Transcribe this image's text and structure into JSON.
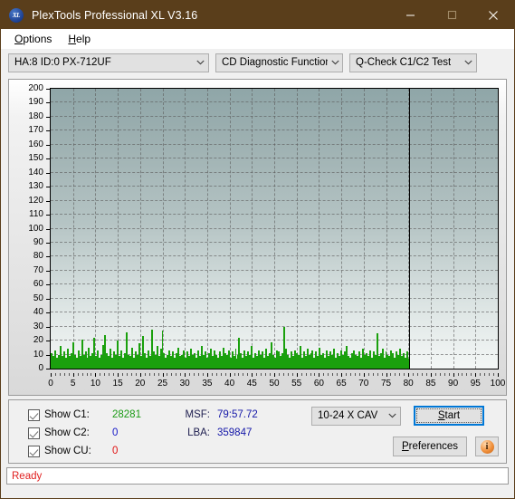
{
  "window": {
    "title": "PlexTools Professional XL V3.16",
    "icon": "xl-app-icon",
    "icon_text": "XL",
    "minimize_label": "minimize-icon",
    "maximize_label": "maximize-icon",
    "close_label": "close-icon",
    "titlebar_color": "#5a3e1b"
  },
  "menubar": {
    "items": [
      {
        "label": "Options",
        "accel": "O"
      },
      {
        "label": "Help",
        "accel": "H"
      }
    ]
  },
  "toolbar": {
    "drive_combo": {
      "value": "HA:8 ID:0  PX-712UF",
      "icon": "chevron-down-icon"
    },
    "function_combo": {
      "value": "CD Diagnostic Functions",
      "icon": "chevron-down-icon"
    },
    "test_combo": {
      "value": "Q-Check C1/C2 Test",
      "icon": "chevron-down-icon"
    }
  },
  "stats": {
    "checkboxes": [
      {
        "label": "Show C1:",
        "checked": true,
        "value": "28281",
        "color": "#1a9a14"
      },
      {
        "label": "Show C2:",
        "checked": true,
        "value": "0",
        "color": "#1417c8"
      },
      {
        "label": "Show CU:",
        "checked": true,
        "value": "0",
        "color": "#e01010"
      }
    ],
    "msf_key": "MSF:",
    "msf_value": "79:57.72",
    "lba_key": "LBA:",
    "lba_value": "359847",
    "speed_combo": {
      "value": "10-24 X CAV",
      "icon": "chevron-down-icon"
    },
    "start_button": "Start",
    "start_accel": "S",
    "preferences_button": "Preferences",
    "preferences_accel": "P",
    "info_button": "i"
  },
  "statusbar": {
    "text": "Ready",
    "color": "#e02020"
  },
  "chart_data": {
    "type": "bar",
    "title": "",
    "xlabel": "",
    "ylabel": "",
    "xlim": [
      0,
      100
    ],
    "ylim": [
      0,
      200
    ],
    "xticks": [
      0,
      5,
      10,
      15,
      20,
      25,
      30,
      35,
      40,
      45,
      50,
      55,
      60,
      65,
      70,
      75,
      80,
      85,
      90,
      95,
      100
    ],
    "yticks": [
      0,
      10,
      20,
      30,
      40,
      50,
      60,
      70,
      80,
      90,
      100,
      110,
      120,
      130,
      140,
      150,
      160,
      170,
      180,
      190,
      200
    ],
    "grid": true,
    "legend_position": "none",
    "series_color": "#1aa00d",
    "marker_x": 80.2,
    "data_end_x": 80.2,
    "series": [
      {
        "name": "C1",
        "color": "#1aa00d",
        "x": [
          0.2,
          0.6,
          1.0,
          1.4,
          1.8,
          2.2,
          2.6,
          3.0,
          3.4,
          3.8,
          4.2,
          4.6,
          5.0,
          5.4,
          5.8,
          6.2,
          6.6,
          7.0,
          7.4,
          7.8,
          8.2,
          8.6,
          9.0,
          9.4,
          9.8,
          10.2,
          10.6,
          11.0,
          11.4,
          11.8,
          12.2,
          12.6,
          13.0,
          13.4,
          13.8,
          14.2,
          14.6,
          15.0,
          15.4,
          15.8,
          16.2,
          16.6,
          17.0,
          17.4,
          17.8,
          18.2,
          18.6,
          19.0,
          19.4,
          19.8,
          20.2,
          20.6,
          21.0,
          21.4,
          21.8,
          22.2,
          22.6,
          23.0,
          23.4,
          23.8,
          24.2,
          24.6,
          25.0,
          25.4,
          25.8,
          26.2,
          26.6,
          27.0,
          27.4,
          27.8,
          28.2,
          28.6,
          29.0,
          29.4,
          29.8,
          30.2,
          30.6,
          31.0,
          31.4,
          31.8,
          32.2,
          32.6,
          33.0,
          33.4,
          33.8,
          34.2,
          34.6,
          35.0,
          35.4,
          35.8,
          36.2,
          36.6,
          37.0,
          37.4,
          37.8,
          38.2,
          38.6,
          39.0,
          39.4,
          39.8,
          40.2,
          40.6,
          41.0,
          41.4,
          41.8,
          42.2,
          42.6,
          43.0,
          43.4,
          43.8,
          44.2,
          44.6,
          45.0,
          45.4,
          45.8,
          46.2,
          46.6,
          47.0,
          47.4,
          47.8,
          48.2,
          48.6,
          49.0,
          49.4,
          49.8,
          50.2,
          50.6,
          51.0,
          51.4,
          51.8,
          52.2,
          52.6,
          53.0,
          53.4,
          53.8,
          54.2,
          54.6,
          55.0,
          55.4,
          55.8,
          56.2,
          56.6,
          57.0,
          57.4,
          57.8,
          58.2,
          58.6,
          59.0,
          59.4,
          59.8,
          60.2,
          60.6,
          61.0,
          61.4,
          61.8,
          62.2,
          62.6,
          63.0,
          63.4,
          63.8,
          64.2,
          64.6,
          65.0,
          65.4,
          65.8,
          66.2,
          66.6,
          67.0,
          67.4,
          67.8,
          68.2,
          68.6,
          69.0,
          69.4,
          69.8,
          70.2,
          70.6,
          71.0,
          71.4,
          71.8,
          72.2,
          72.6,
          73.0,
          73.4,
          73.8,
          74.2,
          74.6,
          75.0,
          75.4,
          75.8,
          76.2,
          76.6,
          77.0,
          77.4,
          77.8,
          78.2,
          78.6,
          79.0,
          79.4,
          79.8
        ],
        "y": [
          11,
          9,
          13,
          8,
          10,
          16,
          9,
          12,
          8,
          14,
          9,
          11,
          19,
          10,
          8,
          13,
          9,
          21,
          10,
          12,
          8,
          15,
          9,
          11,
          22,
          9,
          13,
          8,
          10,
          17,
          24,
          11,
          9,
          14,
          8,
          12,
          10,
          20,
          9,
          13,
          8,
          11,
          26,
          10,
          9,
          15,
          8,
          12,
          10,
          18,
          9,
          23,
          11,
          8,
          13,
          9,
          28,
          12,
          10,
          16,
          9,
          14,
          27,
          11,
          8,
          10,
          13,
          9,
          12,
          8,
          11,
          15,
          9,
          10,
          13,
          8,
          12,
          9,
          14,
          10,
          11,
          8,
          13,
          9,
          16,
          10,
          12,
          8,
          11,
          14,
          9,
          13,
          10,
          8,
          12,
          9,
          15,
          11,
          10,
          13,
          8,
          12,
          9,
          14,
          10,
          22,
          11,
          8,
          13,
          9,
          12,
          10,
          16,
          8,
          11,
          9,
          13,
          10,
          12,
          8,
          14,
          9,
          11,
          19,
          10,
          8,
          13,
          12,
          9,
          11,
          30,
          14,
          10,
          8,
          12,
          9,
          13,
          11,
          10,
          16,
          8,
          12,
          9,
          14,
          10,
          11,
          13,
          8,
          12,
          9,
          15,
          10,
          11,
          8,
          13,
          9,
          12,
          10,
          14,
          8,
          11,
          9,
          13,
          10,
          12,
          16,
          9,
          8,
          11,
          13,
          10,
          9,
          12,
          8,
          14,
          10,
          11,
          9,
          13,
          8,
          12,
          10,
          25,
          9,
          11,
          14,
          8,
          12,
          10,
          9,
          13,
          11,
          8,
          12,
          10,
          14,
          9,
          11,
          8,
          12,
          10,
          13,
          9
        ]
      }
    ]
  }
}
